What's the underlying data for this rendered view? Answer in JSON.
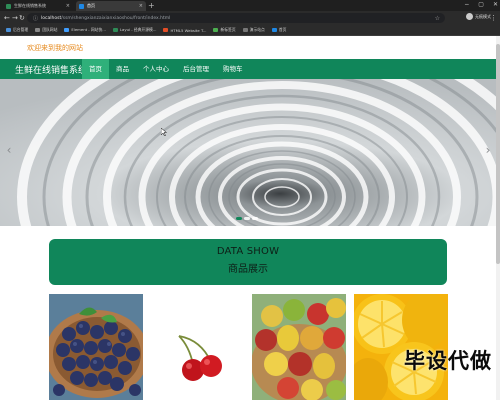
{
  "browser": {
    "tabs": [
      {
        "title": "生鲜在线销售系统",
        "active": false
      },
      {
        "title": "首页",
        "active": true
      }
    ],
    "new_tab": "+",
    "window_controls": [
      "−",
      "▢",
      "✕"
    ],
    "nav": {
      "back": "←",
      "forward": "→",
      "reload": "↻"
    },
    "address": {
      "host": "localhost",
      "path": "/ssm/shengxianzaixianxiaoshou/front/index.html"
    },
    "profile_name": "无痕模式",
    "bookmarks": [
      {
        "label": "后台管理",
        "color": "#4a90d9"
      },
      {
        "label": "团队网站",
        "color": "#888888"
      },
      {
        "label": "Element - 网站快...",
        "color": "#409eff"
      },
      {
        "label": "Layui - 经典开源模...",
        "color": "#2e8b57"
      },
      {
        "label": "HTML5 Website T...",
        "color": "#e44d26"
      },
      {
        "label": "新标签页",
        "color": "#4caf50"
      },
      {
        "label": "演示站点",
        "color": "#777777"
      },
      {
        "label": "首页",
        "color": "#1e88e5"
      }
    ]
  },
  "site": {
    "welcome": "欢迎来到我的网站",
    "brand": "生鲜在线销售系统",
    "nav_items": [
      {
        "label": "首页",
        "active": true
      },
      {
        "label": "商品",
        "active": false
      },
      {
        "label": "个人中心",
        "active": false
      },
      {
        "label": "后台管理",
        "active": false
      },
      {
        "label": "购物车",
        "active": false
      }
    ],
    "banner": {
      "prev_arrow": "‹",
      "next_arrow": "›",
      "slides": 3,
      "active_slide": 1
    },
    "section": {
      "title_en": "DATA SHOW",
      "title_cn": "商品展示"
    },
    "products": [
      {
        "name": "blueberry",
        "icon": "blueberry-image"
      },
      {
        "name": "cherry",
        "icon": "cherry-image"
      },
      {
        "name": "mixed-fruit",
        "icon": "fruit-basket-image"
      },
      {
        "name": "lemon",
        "icon": "lemon-image"
      }
    ],
    "watermark": "毕设代做"
  },
  "colors": {
    "primary": "#10865a",
    "nav_active": "#2fb07a",
    "welcome": "#e68a1e"
  }
}
